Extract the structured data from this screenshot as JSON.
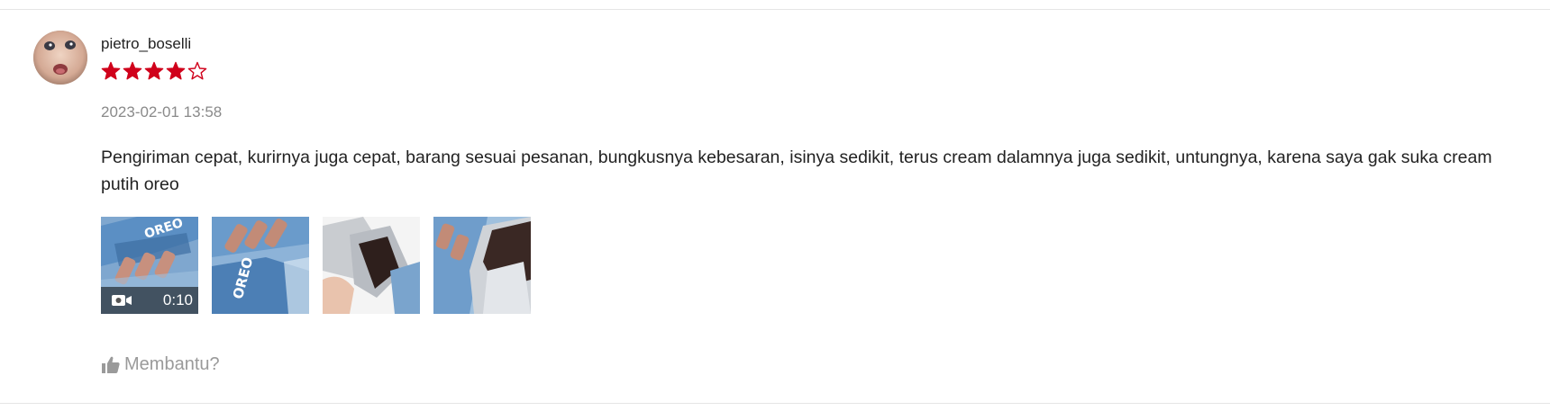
{
  "review": {
    "username": "pietro_boselli",
    "rating": 4,
    "rating_max": 5,
    "star_color": "#d0011b",
    "timestamp": "2023-02-01 13:58",
    "text": "Pengiriman cepat, kurirnya juga cepat, barang sesuai pesanan, bungkusnya kebesaran, isinya sedikit, terus cream dalamnya juga sedikit, untungnya, karena saya gak suka cream putih oreo",
    "media": [
      {
        "type": "video",
        "icon": "video-camera-icon",
        "duration": "0:10"
      },
      {
        "type": "image"
      },
      {
        "type": "image"
      },
      {
        "type": "image"
      }
    ],
    "helpful_label": "Membantu?",
    "helpful_icon": "thumbs-up-icon"
  }
}
